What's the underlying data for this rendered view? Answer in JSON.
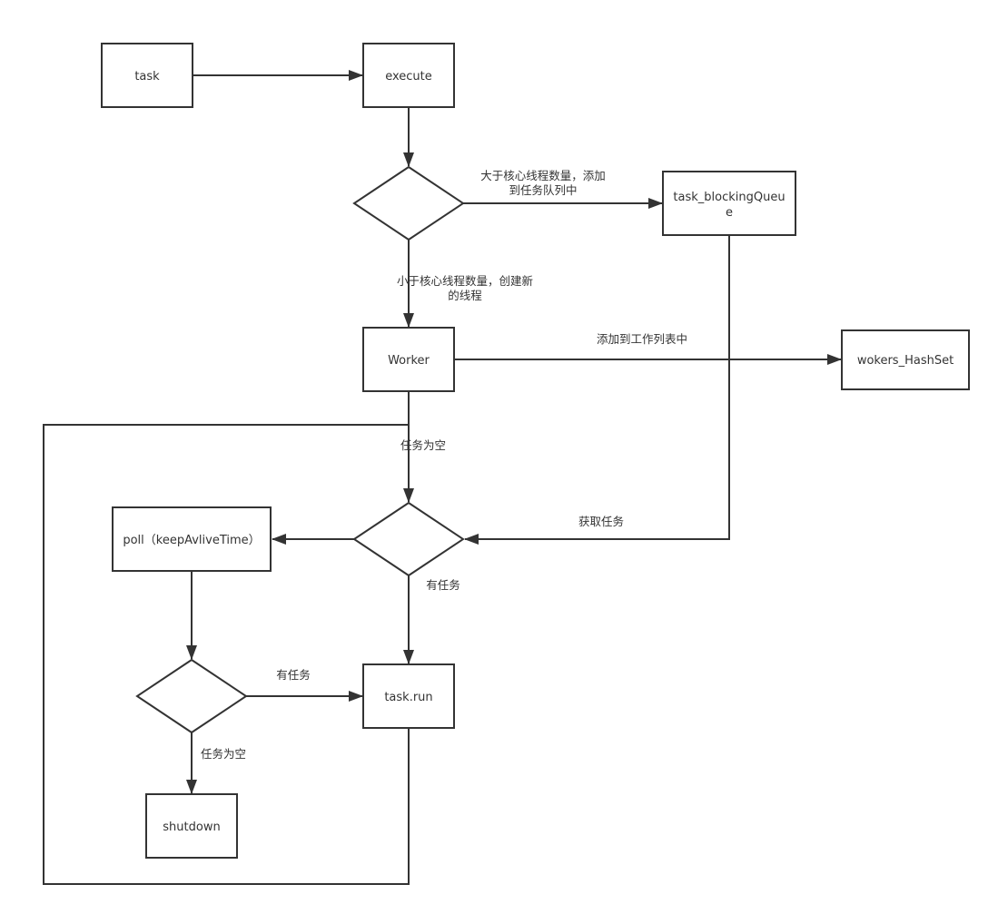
{
  "diagram": {
    "colors": {
      "stroke": "#333333",
      "background": "#ffffff",
      "text": "#333333"
    },
    "nodes": {
      "task": "task",
      "execute": "execute",
      "blocking_queue_line1": "task_blockingQueu",
      "blocking_queue_line2": "e",
      "worker": "Worker",
      "workers_hashset": "wokers_HashSet",
      "poll": "poll（keepAvliveTime）",
      "task_run": "task.run",
      "shutdown": "shutdown"
    },
    "edge_labels": {
      "gt_core_line1": "大于核心线程数量，添加",
      "gt_core_line2": "到任务队列中",
      "lt_core_line1": "小于核心线程数量，创建新",
      "lt_core_line2": "的线程",
      "add_to_worker_list": "添加到工作列表中",
      "task_empty_top": "任务为空",
      "get_task": "获取任务",
      "has_task_down": "有任务",
      "has_task_right": "有任务",
      "task_empty_bottom": "任务为空"
    }
  }
}
